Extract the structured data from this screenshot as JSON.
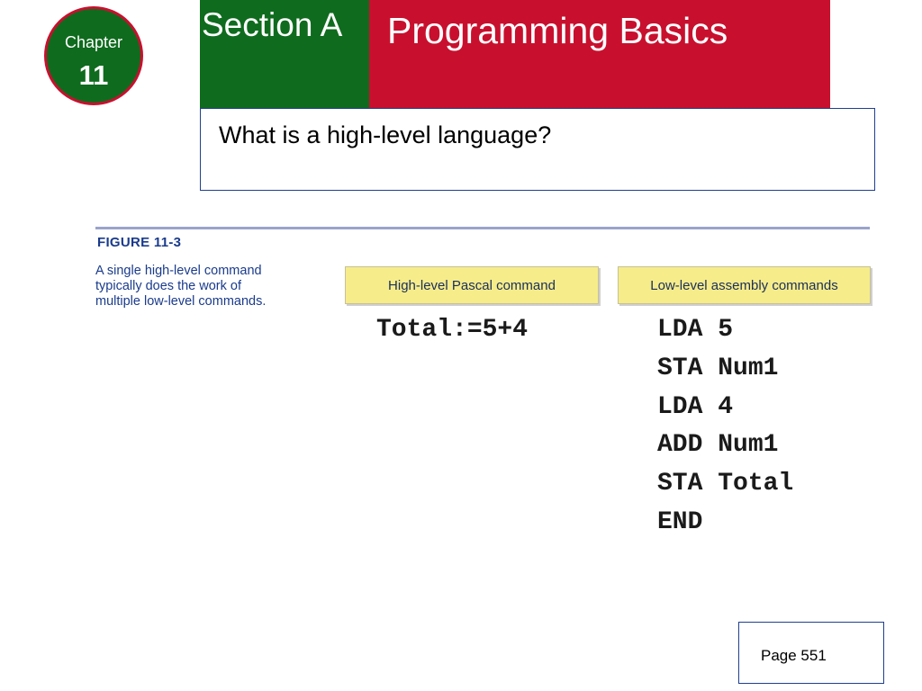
{
  "chapter": {
    "word": "Chapter",
    "number": "11"
  },
  "header": {
    "section": "Section A",
    "title": "Programming Basics"
  },
  "question": "What is a high-level language?",
  "figure": {
    "label": "FIGURE 11-3",
    "caption_lines": [
      "A single high-level command",
      "typically does the work of",
      "multiple low-level commands."
    ],
    "high_level_header": "High-level Pascal command",
    "low_level_header": "Low-level assembly commands",
    "high_level_command": "Total:=5+4",
    "assembly_commands": [
      "LDA 5",
      "STA Num1",
      "LDA 4",
      "ADD Num1",
      "STA Total",
      "END"
    ]
  },
  "page": "Page 551",
  "colors": {
    "green": "#0f6b1e",
    "red": "#c8102e",
    "header_yellow": "#f6ec8a",
    "figure_blue": "#1a3b8c"
  }
}
